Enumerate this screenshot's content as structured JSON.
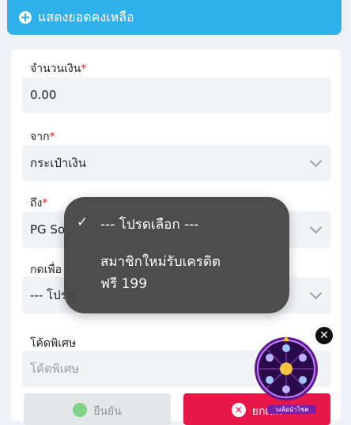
{
  "banner": {
    "label": "แสดงยอดคงเหลือ",
    "icon": "plus-circle-icon"
  },
  "form": {
    "amount": {
      "label": "จำนวนเงิน",
      "value": "0.00"
    },
    "from": {
      "label": "จาก",
      "value": "กระเป๋าเงิน"
    },
    "to": {
      "label": "ถึง",
      "value": "PG So"
    },
    "promo": {
      "label": "กดเพื่อ",
      "value": "--- โปรด"
    },
    "code": {
      "label": "โค้ดพิเศษ",
      "placeholder": "โค้ดพิเศษ"
    },
    "required_mark": "*"
  },
  "dropdown": {
    "options": [
      {
        "label": "--- โปรดเลือก ---",
        "selected": true
      },
      {
        "label_line1": "สมาชิกใหม่รับเครดิต",
        "label_line2": "ฟรี 199",
        "selected": false
      }
    ],
    "check_glyph": "✓"
  },
  "buttons": {
    "confirm_label": "ยืนยัน",
    "cancel_label": "ยกเลิก"
  },
  "wheel": {
    "label": "วงล้อนำโชค",
    "close_glyph": "✕"
  },
  "colors": {
    "accent": "#2fb1ec",
    "cancel": "#e8174a",
    "required": "#e02424"
  }
}
